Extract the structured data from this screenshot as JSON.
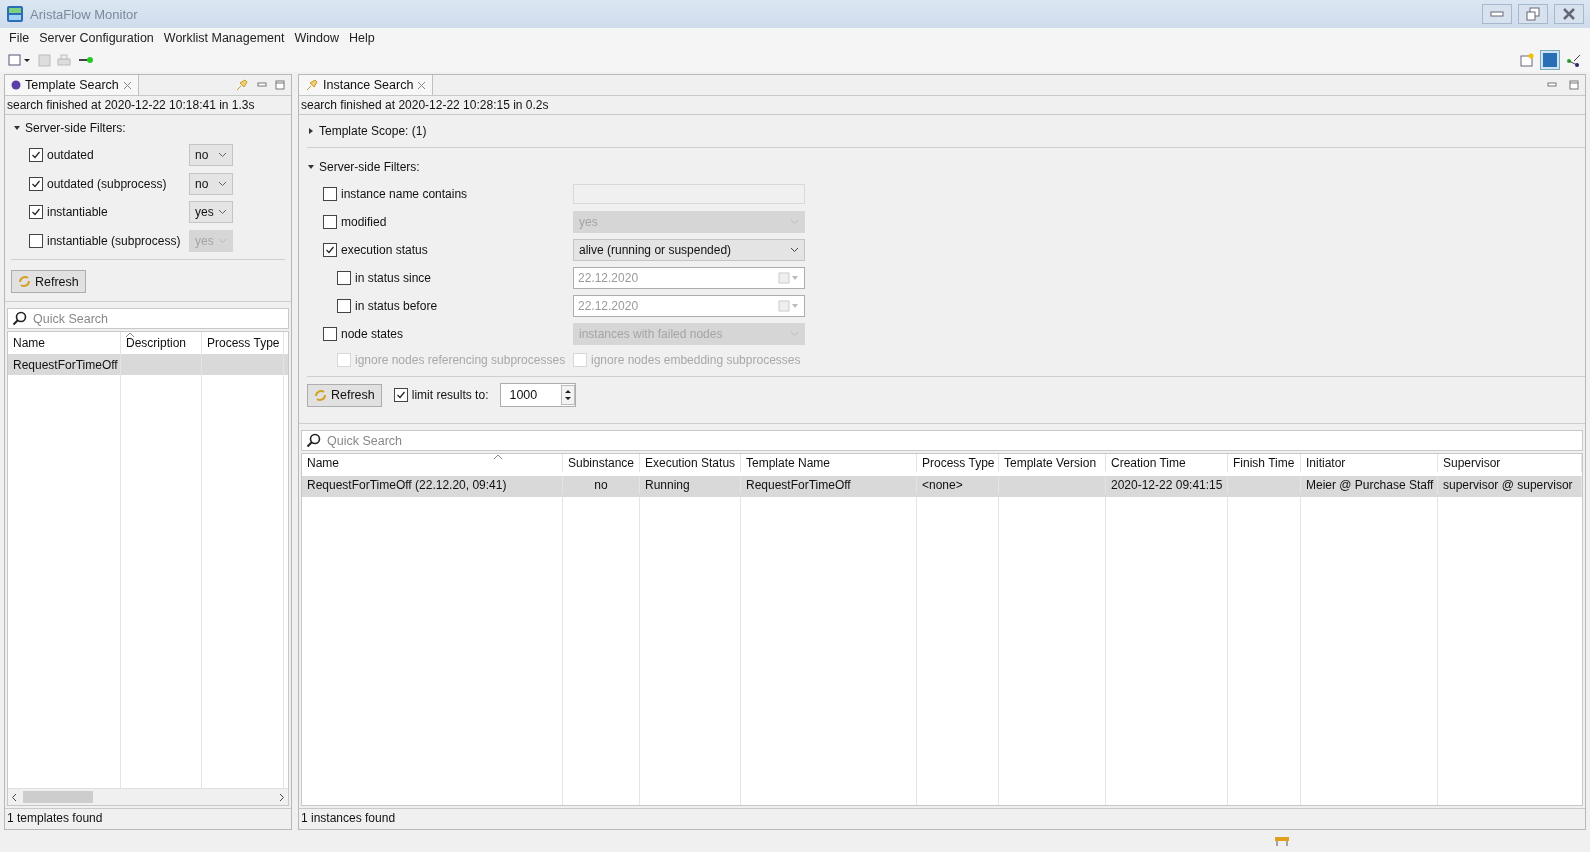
{
  "window": {
    "title": "AristaFlow Monitor"
  },
  "menu": [
    "File",
    "Server Configuration",
    "Worklist Management",
    "Window",
    "Help"
  ],
  "left_panel": {
    "tab": {
      "label": "Template Search",
      "selected": true
    },
    "status": "search finished at 2020-12-22 10:18:41 in 1.3s",
    "filters_section": {
      "label": "Server-side Filters:",
      "expanded": true
    },
    "filters": [
      {
        "label": "outdated",
        "checked": true,
        "value": "no",
        "disabled": false
      },
      {
        "label": "outdated (subprocess)",
        "checked": true,
        "value": "no",
        "disabled": false
      },
      {
        "label": "instantiable",
        "checked": true,
        "value": "yes",
        "disabled": false
      },
      {
        "label": "instantiable (subprocess)",
        "checked": false,
        "value": "yes",
        "disabled": true
      }
    ],
    "refresh": "Refresh",
    "search": {
      "placeholder": "Quick Search"
    },
    "table": {
      "columns": [
        "Name",
        "Description",
        "Process Type"
      ],
      "rows": [
        {
          "cells": [
            "RequestForTimeOff",
            "",
            ""
          ],
          "selected": true
        }
      ]
    },
    "footer": "1 templates found"
  },
  "right_panel": {
    "tab": {
      "label": "Instance Search",
      "selected": true
    },
    "status": "search finished at 2020-12-22 10:28:15 in 0.2s",
    "scope_section": {
      "label": "Template Scope: (1)",
      "expanded": false
    },
    "filters_section": {
      "label": "Server-side Filters:",
      "expanded": true
    },
    "filters": [
      {
        "kind": "text",
        "label": "instance name contains",
        "checked": false,
        "disabled": true
      },
      {
        "kind": "select",
        "label": "modified",
        "checked": false,
        "value": "yes",
        "disabled": true
      },
      {
        "kind": "select",
        "label": "execution status",
        "checked": true,
        "value": "alive (running or suspended)",
        "disabled": false,
        "children": [
          {
            "kind": "date",
            "label": "in status since",
            "checked": false,
            "value": "22.12.2020",
            "disabled": true
          },
          {
            "kind": "date",
            "label": "in status before",
            "checked": false,
            "value": "22.12.2020",
            "disabled": true
          }
        ]
      },
      {
        "kind": "select",
        "label": "node states",
        "checked": false,
        "value": "instances with failed nodes",
        "disabled": true
      }
    ],
    "options": [
      {
        "label": "ignore nodes referencing subprocesses",
        "checked": false,
        "disabled": true
      },
      {
        "label": "ignore nodes embedding subprocesses",
        "checked": false,
        "disabled": true
      }
    ],
    "refresh": "Refresh",
    "limit": {
      "label": "limit results to:",
      "checked": true,
      "value": "1000"
    },
    "search": {
      "placeholder": "Quick Search"
    },
    "table": {
      "columns": [
        "Name",
        "Subinstance",
        "Execution Status",
        "Template Name",
        "Process Type",
        "Template Version",
        "Creation Time",
        "Finish Time",
        "Initiator",
        "Supervisor"
      ],
      "rows": [
        {
          "cells": [
            "RequestForTimeOff (22.12.20, 09:41)",
            "no",
            "Running",
            "RequestForTimeOff",
            "<none>",
            "",
            "2020-12-22 09:41:15",
            "",
            "Meier @ Purchase Staff",
            "supervisor @ supervisor"
          ],
          "selected": true
        }
      ]
    },
    "footer": "1 instances found"
  }
}
